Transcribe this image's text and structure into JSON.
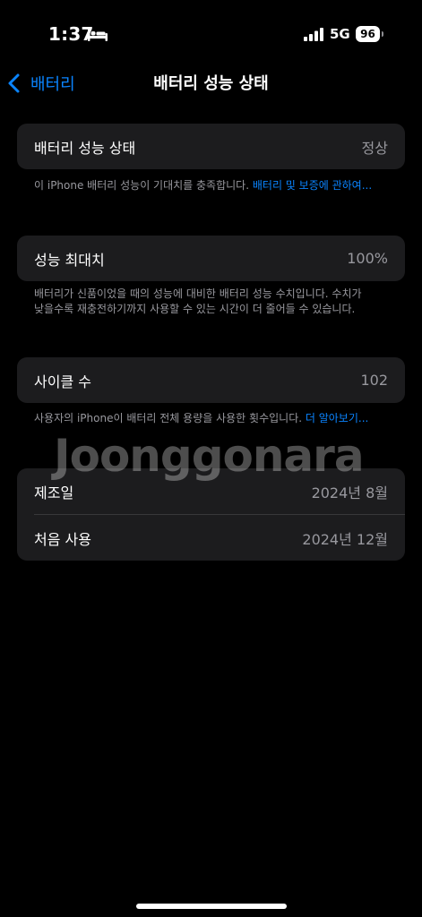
{
  "status_bar": {
    "time": "1:37",
    "network": "5G",
    "battery_level": "96"
  },
  "nav": {
    "back_label": "배터리",
    "title": "배터리 성능 상태"
  },
  "health_card": {
    "label": "배터리 성능 상태",
    "value": "정상"
  },
  "health_note": {
    "text": "이 iPhone 배터리 성능이 기대치를 충족합니다. ",
    "link": "배터리 및 보증에 관하여..."
  },
  "capacity_card": {
    "label": "성능 최대치",
    "value": "100%"
  },
  "capacity_note": {
    "text": "배터리가 신품이었을 때의 성능에 대비한 배터리 성능 수치입니다. 수치가 낮을수록 재충전하기까지 사용할 수 있는 시간이 더 줄어들 수 있습니다."
  },
  "cycle_card": {
    "label": "사이클 수",
    "value": "102"
  },
  "cycle_note": {
    "text": "사용자의 iPhone이 배터리 전체 용량을 사용한 횟수입니다. ",
    "link": "더 알아보기..."
  },
  "info_card": {
    "rows": [
      {
        "label": "제조일",
        "value": "2024년 8월"
      },
      {
        "label": "처음 사용",
        "value": "2024년 12월"
      }
    ]
  },
  "watermark": "Joonggonara"
}
